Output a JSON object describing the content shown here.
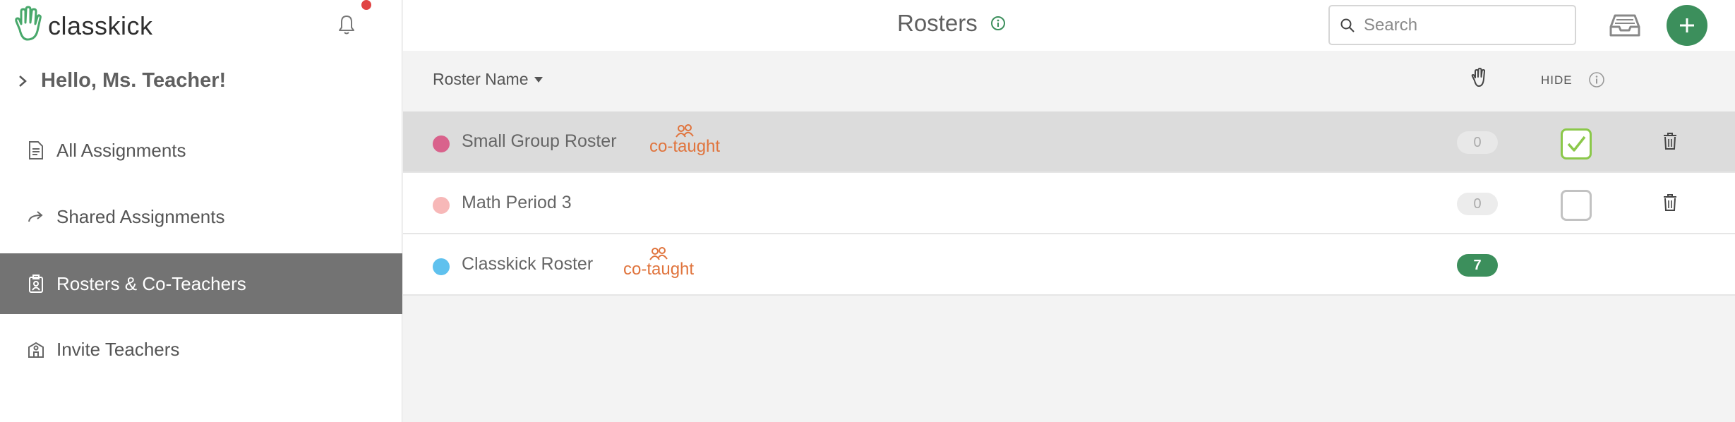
{
  "app": {
    "logo_text": "classkick"
  },
  "sidebar": {
    "greeting": "Hello, Ms. Teacher!",
    "items": [
      {
        "label": "All Assignments",
        "icon": "document-icon",
        "active": false
      },
      {
        "label": "Shared Assignments",
        "icon": "share-arrow-icon",
        "active": false
      },
      {
        "label": "Rosters & Co-Teachers",
        "icon": "roster-badge-icon",
        "active": true
      },
      {
        "label": "Invite Teachers",
        "icon": "school-building-icon",
        "active": false
      }
    ]
  },
  "header": {
    "title": "Rosters",
    "search_placeholder": "Search"
  },
  "table": {
    "col_name": "Roster Name",
    "col_hide": "HIDE",
    "rows": [
      {
        "name": "Small Group Roster",
        "color": "#d9628c",
        "co_taught": "co-taught",
        "count": "0",
        "hidden": true,
        "selected": true
      },
      {
        "name": "Math Period 3",
        "color": "#f7b8b8",
        "co_taught": "",
        "count": "0",
        "hidden": false,
        "selected": false
      },
      {
        "name": "Classkick Roster",
        "color": "#5fc1ee",
        "co_taught": "co-taught",
        "count": "7",
        "hidden": null,
        "selected": false
      }
    ]
  },
  "colors": {
    "accent_green": "#3c8f5c",
    "co_taught_orange": "#e0743d",
    "check_green": "#8bc84a"
  }
}
